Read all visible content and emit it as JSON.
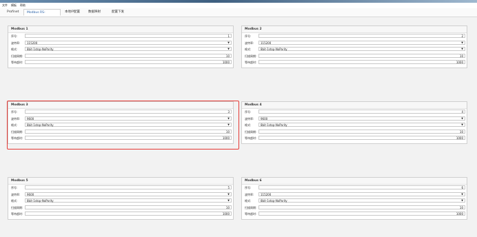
{
  "menubar": {
    "items": [
      "文件",
      "模板",
      "帮助"
    ]
  },
  "tabs": [
    {
      "label": "Profinet"
    },
    {
      "label": "Modbus RS-485"
    },
    {
      "label": "本地IP配置"
    },
    {
      "label": "数据映射"
    },
    {
      "label": "配置下发"
    }
  ],
  "field_labels": {
    "index": "序号:",
    "baud": "波特率:",
    "format": "格式:",
    "scan": "扫描周期:",
    "timeout": "等待超时:"
  },
  "panels": [
    {
      "title": "Modbus 1",
      "index": "1",
      "baud": "115200",
      "format": "8bit-1stop-NoParity",
      "scan": "10",
      "timeout": "1000"
    },
    {
      "title": "Modbus 2",
      "index": "2",
      "baud": "115200",
      "format": "8bit-1stop-NoParity",
      "scan": "10",
      "timeout": "1000"
    },
    {
      "title": "Modbus 3",
      "index": "3",
      "baud": "9600",
      "format": "8bit-1stop-NoParity",
      "scan": "10",
      "timeout": "1000"
    },
    {
      "title": "Modbus 4",
      "index": "4",
      "baud": "9600",
      "format": "8bit-1stop-NoParity",
      "scan": "10",
      "timeout": "1000"
    },
    {
      "title": "Modbus 5",
      "index": "5",
      "baud": "9600",
      "format": "8bit-1stop-NoParity",
      "scan": "10",
      "timeout": "1000"
    },
    {
      "title": "Modbus 6",
      "index": "6",
      "baud": "115200",
      "format": "8bit-1stop-NoParity",
      "scan": "10",
      "timeout": "1000"
    }
  ],
  "colors": {
    "accent": "#2a62a8",
    "highlight": "#e53935"
  }
}
